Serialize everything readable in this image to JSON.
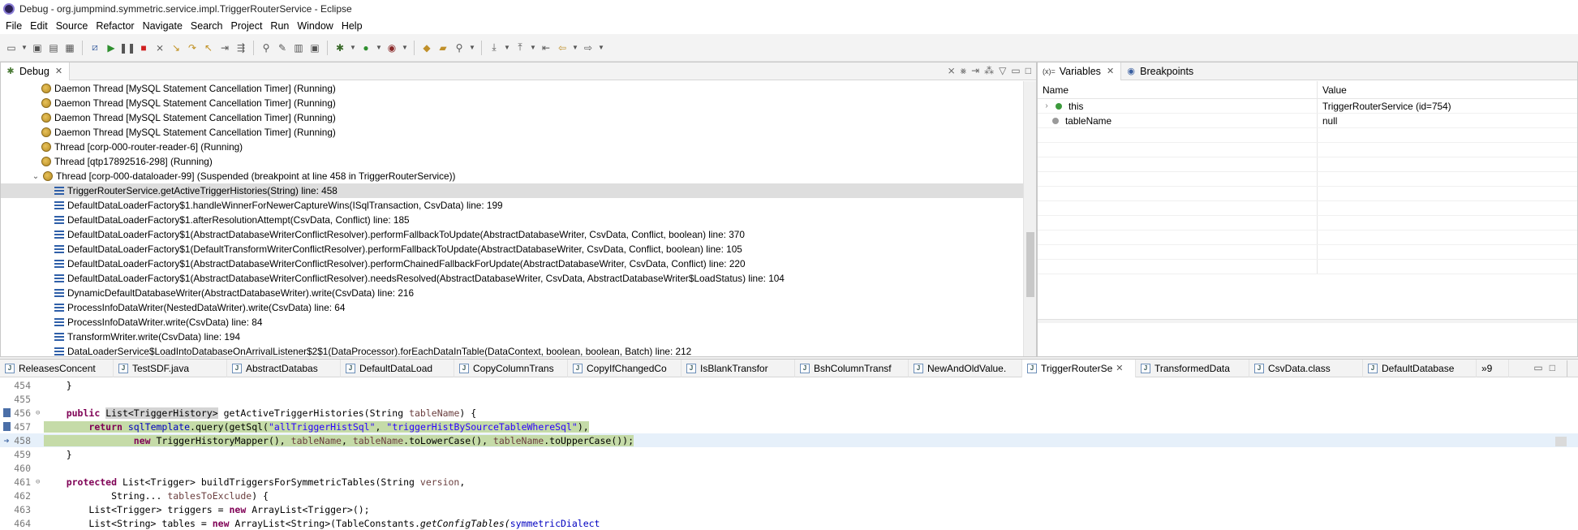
{
  "window": {
    "title": "Debug - org.jumpmind.symmetric.service.impl.TriggerRouterService - Eclipse"
  },
  "menu": [
    "File",
    "Edit",
    "Source",
    "Refactor",
    "Navigate",
    "Search",
    "Project",
    "Run",
    "Window",
    "Help"
  ],
  "debug": {
    "tab_label": "Debug",
    "threads": [
      "Daemon Thread [MySQL Statement Cancellation Timer] (Running)",
      "Daemon Thread [MySQL Statement Cancellation Timer] (Running)",
      "Daemon Thread [MySQL Statement Cancellation Timer] (Running)",
      "Daemon Thread [MySQL Statement Cancellation Timer] (Running)",
      "Thread [corp-000-router-reader-6] (Running)",
      "Thread [qtp17892516-298] (Running)"
    ],
    "suspended_thread": "Thread [corp-000-dataloader-99] (Suspended (breakpoint at line 458 in TriggerRouterService))",
    "frames": [
      "TriggerRouterService.getActiveTriggerHistories(String) line: 458",
      "DefaultDataLoaderFactory$1.handleWinnerForNewerCaptureWins(ISqlTransaction, CsvData) line: 199",
      "DefaultDataLoaderFactory$1.afterResolutionAttempt(CsvData, Conflict) line: 185",
      "DefaultDataLoaderFactory$1(AbstractDatabaseWriterConflictResolver).performFallbackToUpdate(AbstractDatabaseWriter, CsvData, Conflict, boolean) line: 370",
      "DefaultDataLoaderFactory$1(DefaultTransformWriterConflictResolver).performFallbackToUpdate(AbstractDatabaseWriter, CsvData, Conflict, boolean) line: 105",
      "DefaultDataLoaderFactory$1(AbstractDatabaseWriterConflictResolver).performChainedFallbackForUpdate(AbstractDatabaseWriter, CsvData, Conflict) line: 220",
      "DefaultDataLoaderFactory$1(AbstractDatabaseWriterConflictResolver).needsResolved(AbstractDatabaseWriter, CsvData, AbstractDatabaseWriter$LoadStatus) line: 104",
      "DynamicDefaultDatabaseWriter(AbstractDatabaseWriter).write(CsvData) line: 216",
      "ProcessInfoDataWriter(NestedDataWriter).write(CsvData) line: 64",
      "ProcessInfoDataWriter.write(CsvData) line: 84",
      "TransformWriter.write(CsvData) line: 194",
      "DataLoaderService$LoadIntoDatabaseOnArrivalListener$2$1(DataProcessor).forEachDataInTable(DataContext, boolean, boolean, Batch) line: 212"
    ]
  },
  "variables": {
    "tab_label": "Variables",
    "breakpoints_tab_label": "Breakpoints",
    "col_name": "Name",
    "col_value": "Value",
    "rows": [
      {
        "name": "this",
        "value": "TriggerRouterService  (id=754)"
      },
      {
        "name": "tableName",
        "value": "null"
      }
    ]
  },
  "editor": {
    "tabs": [
      "ReleasesConcent",
      "TestSDF.java",
      "AbstractDatabas",
      "DefaultDataLoad",
      "CopyColumnTrans",
      "CopyIfChangedCo",
      "IsBlankTransfor",
      "BshColumnTransf",
      "NewAndOldValue.",
      "TriggerRouterSe",
      "TransformedData",
      "CsvData.class",
      "DefaultDatabase"
    ],
    "overflow_label": "»9",
    "line_numbers": [
      "454",
      "455",
      "456",
      "457",
      "458",
      "459",
      "460",
      "461",
      "462",
      "463",
      "464"
    ],
    "code": {
      "l454": "    }",
      "l455": "",
      "l456_a": "    ",
      "l456_kw": "public",
      "l456_sp": " ",
      "l456_type": "List<TriggerHistory>",
      "l456_b": " getActiveTriggerHistories(String ",
      "l456_param": "tableName",
      "l456_c": ") {",
      "l457_a": "        ",
      "l457_kw": "return",
      "l457_sp": " ",
      "l457_fld": "sqlTemplate",
      "l457_b": ".query(getSql(",
      "l457_s1": "\"allTriggerHistSql\"",
      "l457_c": ", ",
      "l457_s2": "\"triggerHistBySourceTableWhereSql\"",
      "l457_d": "),",
      "l458_a": "                ",
      "l458_kw": "new",
      "l458_b": " TriggerHistoryMapper(), ",
      "l458_p1": "tableName",
      "l458_c": ", ",
      "l458_p2": "tableName",
      "l458_d": ".toLowerCase(), ",
      "l458_p3": "tableName",
      "l458_e": ".toUpperCase());",
      "l459": "    }",
      "l460": "",
      "l461_a": "    ",
      "l461_kw": "protected",
      "l461_b": " List<Trigger> buildTriggersForSymmetricTables(String ",
      "l461_param": "version",
      "l461_c": ",",
      "l462_a": "            String... ",
      "l462_param": "tablesToExclude",
      "l462_b": ") {",
      "l463_a": "        List<Trigger> triggers = ",
      "l463_kw": "new",
      "l463_b": " ArrayList<Trigger>();",
      "l464_a": "        List<String> tables = ",
      "l464_kw": "new",
      "l464_b": " ArrayList<String>(TableConstants.",
      "l464_c": "getConfigTables(",
      "l464_fld": "symmetricDialect"
    }
  },
  "icons": {
    "app": "eclipse-icon",
    "thread": "thread-icon",
    "frame": "stack-frame-icon",
    "java_file": "java-file-icon"
  },
  "colors": {
    "keyword": "#7f0055",
    "string": "#2a00ff",
    "field": "#0000c0",
    "current_line": "#c5dba8"
  }
}
